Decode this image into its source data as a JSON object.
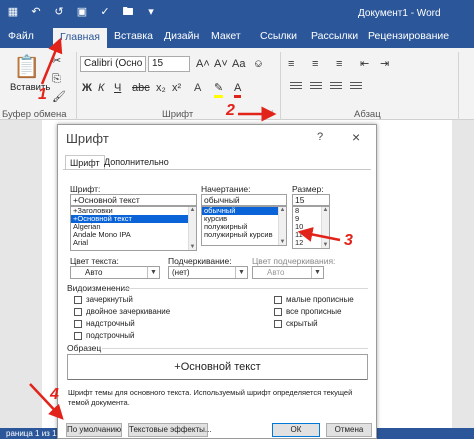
{
  "window": {
    "title": "Документ1 - Word"
  },
  "ribbon": {
    "tabs": [
      "Файл",
      "Главная",
      "Вставка",
      "Дизайн",
      "Макет",
      "Ссылки",
      "Рассылки",
      "Рецензирование"
    ],
    "active_tab": "Главная",
    "paste_label": "Вставить",
    "font_name": "Calibri (Осно",
    "font_size": "15",
    "groups": {
      "clipboard": "Буфер обмена",
      "font": "Шрифт",
      "paragraph": "Абзац"
    }
  },
  "statusbar": {
    "text": "раница 1 из 1"
  },
  "dialog": {
    "title": "Шрифт",
    "help": "?",
    "close": "×",
    "tabs": [
      "Шрифт",
      "Дополнительно"
    ],
    "font": {
      "label": "Шрифт:",
      "value": "+Основной текст",
      "items": [
        "+Заголовки",
        "+Основной текст",
        "Algerian",
        "Andale Mono IPA",
        "Arial"
      ],
      "selected": "+Основной текст"
    },
    "style": {
      "label": "Начертание:",
      "value": "обычный",
      "items": [
        "обычный",
        "курсив",
        "полужирный",
        "полужирный курсив"
      ],
      "selected": "обычный"
    },
    "size": {
      "label": "Размер:",
      "value": "15",
      "items": [
        "8",
        "9",
        "10",
        "11",
        "12"
      ]
    },
    "font_color": {
      "label": "Цвет текста:",
      "value": "Авто"
    },
    "underline": {
      "label": "Подчеркивание:",
      "value": "(нет)"
    },
    "underline_color": {
      "label": "Цвет подчеркивания:",
      "value": "Авто"
    },
    "effects": {
      "label": "Видоизменение",
      "left": [
        "зачеркнутый",
        "двойное зачеркивание",
        "надстрочный",
        "подстрочный"
      ],
      "right": [
        "малые прописные",
        "все прописные",
        "скрытый"
      ]
    },
    "sample": {
      "label": "Образец",
      "text": "+Основной текст"
    },
    "description": "Шрифт темы для основного текста. Используемый шрифт определяется текущей темой документа.",
    "buttons": {
      "default": "По умолчанию",
      "effects": "Текстовые эффекты...",
      "ok": "ОК",
      "cancel": "Отмена"
    }
  },
  "annotations": {
    "numbers": [
      "1",
      "2",
      "3",
      "4"
    ],
    "color": "#e2231a"
  }
}
